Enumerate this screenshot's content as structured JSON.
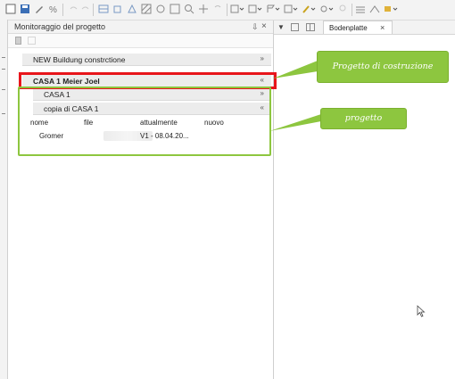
{
  "panel": {
    "title": "Monitoraggio del progetto",
    "pin_glyph": "⇩",
    "close_glyph": "×"
  },
  "tree": {
    "rows": [
      {
        "label": "NEW Buildung constrctione",
        "chevron": "»",
        "expanded": false
      },
      {
        "label": "CASA 1 Meier  Joel",
        "chevron": "«",
        "expanded": true
      },
      {
        "label": "CASA 1",
        "chevron": "»",
        "expanded": false
      },
      {
        "label": "copia di CASA 1",
        "chevron": "«",
        "expanded": true
      }
    ]
  },
  "table": {
    "columns": [
      "nome",
      "file",
      "attualmente",
      "nuovo"
    ],
    "rows": [
      {
        "nome": "Gromer",
        "file": "",
        "attualmente": "V1 - 08.04.20...",
        "nuovo": ""
      }
    ]
  },
  "annotations": {
    "callout_construction": "Progetto di costruzione",
    "callout_project": "progetto",
    "accent_green": "#8dc63f",
    "accent_red": "#e8151b"
  },
  "document": {
    "tab_label": "Bodenplatte",
    "tab_close": "×",
    "dropdown_glyph": "▼"
  },
  "icons": [
    "new-icon",
    "save-icon",
    "tools-icon",
    "layers-icon",
    "grid-icon",
    "zoom-icon",
    "move-icon",
    "dimension-icon",
    "dropdown-icon",
    "chevron-icon",
    "close-icon",
    "pin-icon",
    "cursor-icon"
  ]
}
